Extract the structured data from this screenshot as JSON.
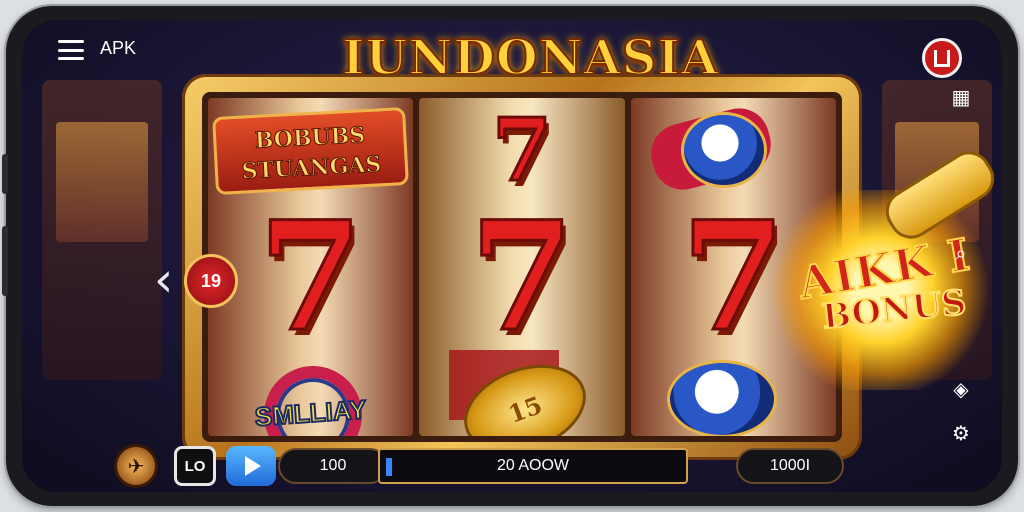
{
  "header": {
    "menu_label": "APK",
    "title": "IUNDONASIA"
  },
  "reels": {
    "banner_text": "BOBUBS STUANGAS",
    "smlly_text": "SMLLIAY",
    "coin_text": "15",
    "seven": "7"
  },
  "left_badge": "19",
  "bonus": {
    "line1": "AIKK I",
    "line2": "BONUS"
  },
  "bottom_bar": {
    "lo_label": "LO",
    "bet_value": "100",
    "message": "20 AOOW",
    "win_value": "1000I"
  },
  "icons": {
    "menu": "hamburger-icon",
    "profile": "profile-icon",
    "right_side": [
      "grid-icon",
      "search-icon",
      "share-icon",
      "settings-icon"
    ],
    "prev": "chevron-left-icon",
    "plane": "plane-icon",
    "play": "play-icon"
  }
}
